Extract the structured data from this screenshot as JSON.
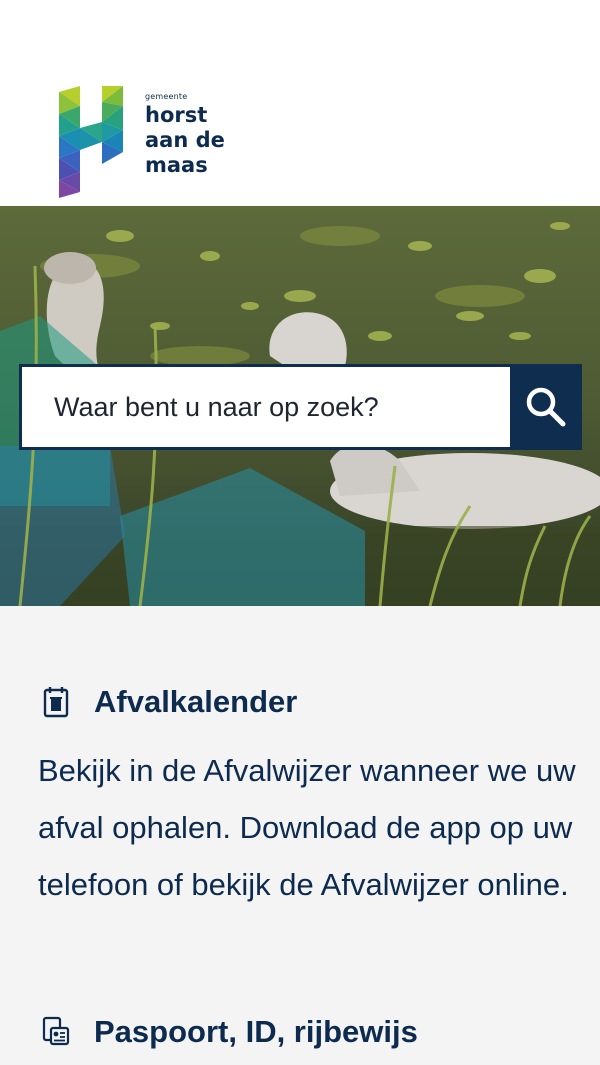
{
  "logo": {
    "small": "gemeente",
    "line1": "horst",
    "line2": "aan de",
    "line3": "maas"
  },
  "search": {
    "placeholder": "Waar bent u naar op zoek?"
  },
  "items": [
    {
      "icon": "trash-calendar-icon",
      "title": "Afvalkalender",
      "description": "Bekijk in de Afvalwijzer wanneer we uw afval ophalen. Download de app op uw telefoon of bekijk de Afvalwijzer online."
    },
    {
      "icon": "id-card-icon",
      "title": "Paspoort, ID, rijbewijs"
    }
  ],
  "colors": {
    "brand_navy": "#0e2d4f",
    "background": "#f4f4f4"
  }
}
